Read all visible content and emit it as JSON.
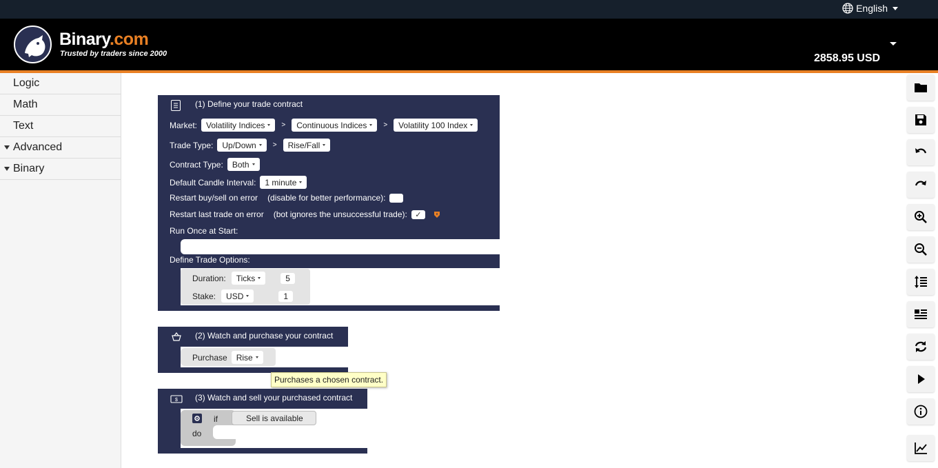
{
  "topbar": {
    "language": "English"
  },
  "header": {
    "brand_name": "Binary",
    "brand_suffix": ".com",
    "tagline": "Trusted by traders since 2000",
    "balance": "2858.95 USD"
  },
  "toolbox": {
    "categories": [
      {
        "label": "Logic"
      },
      {
        "label": "Math"
      },
      {
        "label": "Text"
      },
      {
        "label": "Advanced"
      },
      {
        "label": "Binary"
      }
    ]
  },
  "block1": {
    "title": "(1) Define your trade contract",
    "market_label": "Market:",
    "market": "Volatility Indices",
    "submarket": "Continuous Indices",
    "symbol": "Volatility 100 Index",
    "trade_type_label": "Trade Type:",
    "trade_type": "Up/Down",
    "trade_subtype": "Rise/Fall",
    "contract_type_label": "Contract Type:",
    "contract_type": "Both",
    "candle_label": "Default Candle Interval:",
    "candle": "1 minute",
    "restart_error_label": "Restart buy/sell on error",
    "restart_error_note": "(disable for better performance):",
    "restart_last_label": "Restart last trade on error",
    "restart_last_note": "(bot ignores the unsuccessful trade):",
    "restart_last_check": "✓",
    "run_once_label": "Run Once at Start:",
    "trade_options_label": "Define Trade Options:",
    "duration_label": "Duration:",
    "duration_unit": "Ticks",
    "duration_value": "5",
    "stake_label": "Stake:",
    "stake_currency": "USD",
    "stake_value": "1",
    "sep": ">"
  },
  "block2": {
    "title": "(2) Watch and purchase your contract",
    "purchase_label": "Purchase",
    "purchase_value": "Rise"
  },
  "block3": {
    "title": "(3) Watch and sell your purchased contract",
    "if_label": "if",
    "do_label": "do",
    "condition": "Sell is available"
  },
  "tooltip": "Purchases a chosen contract.",
  "toolbar": {
    "icons": [
      "folder-icon",
      "save-icon",
      "undo-icon",
      "redo-icon",
      "zoom-in-icon",
      "zoom-out-icon",
      "rearrange-icon",
      "list-icon",
      "reset-icon",
      "run-icon",
      "info-icon",
      "chart-icon"
    ]
  }
}
